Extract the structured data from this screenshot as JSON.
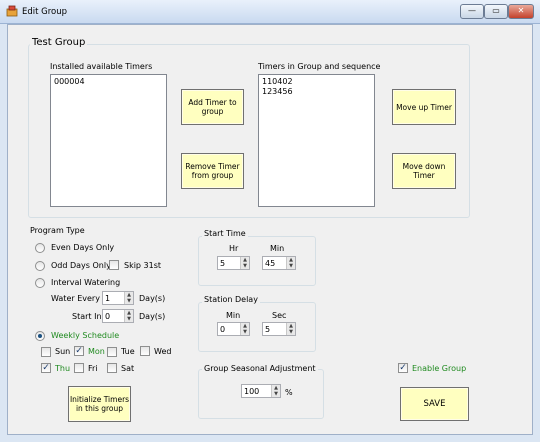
{
  "window": {
    "title": "Edit Group",
    "controls": {
      "minimize": "—",
      "maximize": "▭",
      "close": "✕"
    }
  },
  "test_group": {
    "title": "Test Group",
    "installed_label": "Installed available Timers",
    "installed_items": [
      "000004"
    ],
    "in_group_label": "Timers in Group and sequence",
    "in_group_items": [
      "110402",
      "123456"
    ],
    "add_button": "Add Timer to group",
    "remove_button": "Remove Timer from group",
    "move_up_button": "Move up Timer",
    "move_down_button": "Move down Timer"
  },
  "program_type": {
    "title": "Program Type",
    "even_days": "Even Days Only",
    "odd_days": "Odd Days Only",
    "skip31": "Skip 31st",
    "interval": "Interval Watering",
    "water_every_label": "Water Every",
    "water_every_value": "1",
    "days_label_1": "Day(s)",
    "start_in_label": "Start In",
    "start_in_value": "0",
    "days_label_2": "Day(s)",
    "weekly": "Weekly Schedule",
    "selected": "Weekly Schedule",
    "days": {
      "sun": "Sun",
      "mon": "Mon",
      "tue": "Tue",
      "wed": "Wed",
      "thu": "Thu",
      "fri": "Fri",
      "sat": "Sat"
    },
    "checked_days": [
      "Mon",
      "Thu"
    ],
    "accent_color": "#1f8a1f"
  },
  "start_time": {
    "title": "Start Time",
    "hr_label": "Hr",
    "hr_value": "5",
    "min_label": "Min",
    "min_value": "45"
  },
  "station_delay": {
    "title": "Station Delay",
    "min_label": "Min",
    "min_value": "0",
    "sec_label": "Sec",
    "sec_value": "5"
  },
  "seasonal": {
    "title": "Group Seasonal Adjustment",
    "value": "100",
    "unit": "%"
  },
  "enable_group": {
    "label": "Enable Group",
    "checked": true
  },
  "initialize_button": "Initialize Timers in this group",
  "save_button": "SAVE",
  "colors": {
    "button_yellow": "#ffffc0",
    "title_gradient": "#c9daf0"
  }
}
